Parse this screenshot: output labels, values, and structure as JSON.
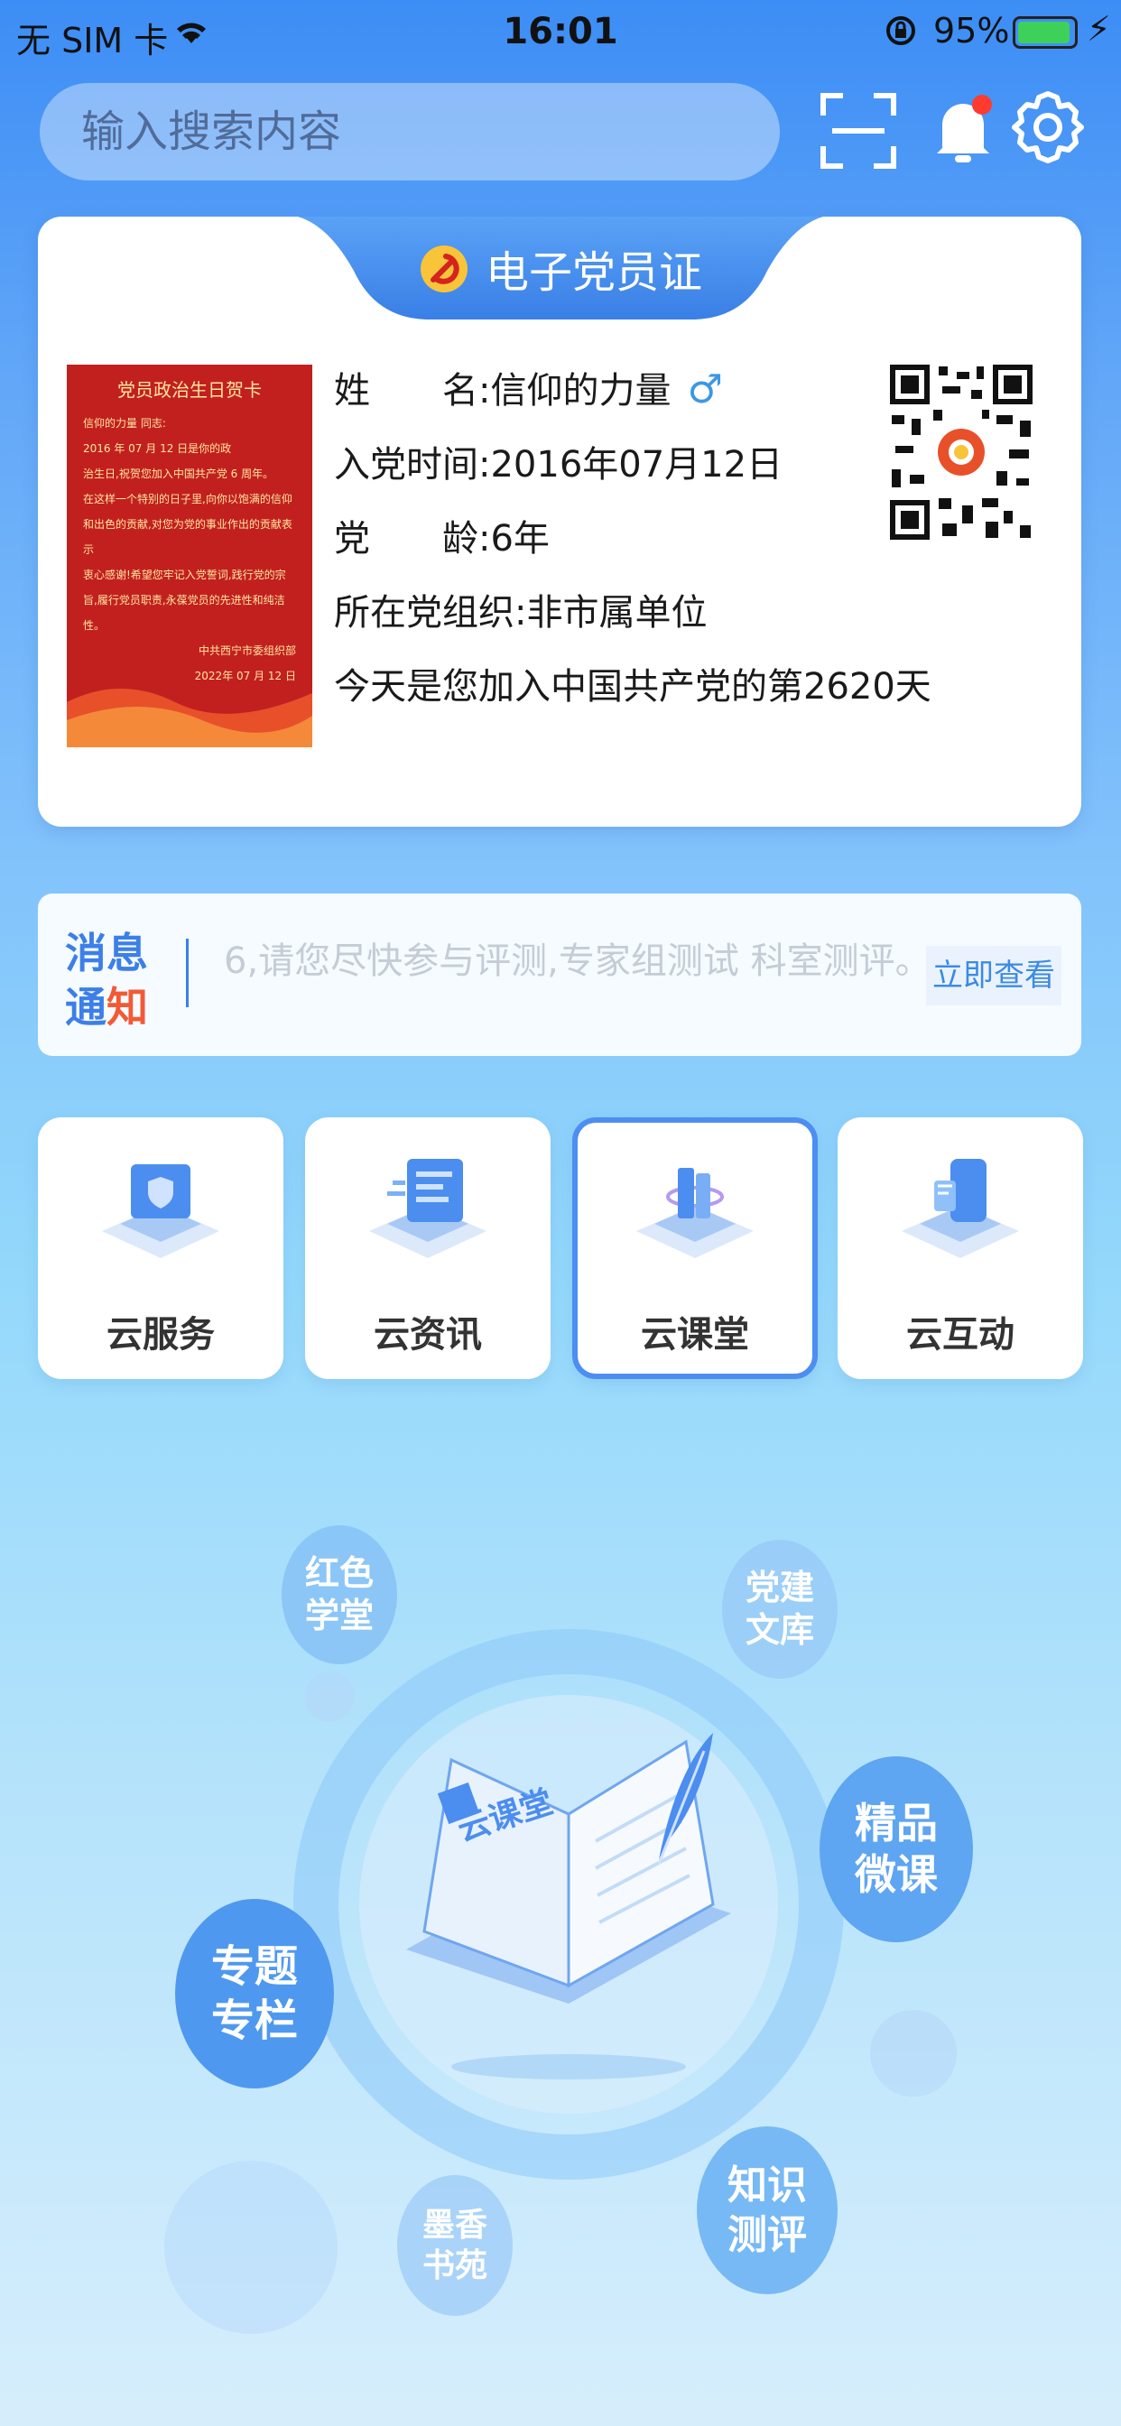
{
  "status_bar": {
    "carrier": "无 SIM 卡",
    "time": "16:01",
    "battery_pct": "95%",
    "battery_level": 0.95
  },
  "search": {
    "placeholder": "输入搜索内容"
  },
  "card": {
    "title": "电子党员证",
    "greeting_title": "党员政治生日贺卡",
    "greeting_lines": [
      "信仰的力量 同志:",
      "2016 年 07 月 12 日是你的政",
      "治生日,祝贺您加入中国共产党 6 周年。",
      "在这样一个特别的日子里,向你以饱满的信仰",
      "和出色的贡献,对您为党的事业作出的贡献表示",
      "衷心感谢!希望您牢记入党誓词,践行党的宗",
      "旨,履行党员职责,永葆党员的先进性和纯洁",
      "性。",
      "中共西宁市委组织部",
      "2022年 07 月 12 日"
    ],
    "name_label": "姓　　名:",
    "name_value": "信仰的力量",
    "join_label": "入党时间:",
    "join_value": "2016年07月12日",
    "age_label": "党　　龄:",
    "age_value": "6年",
    "org_label": "所在党组织:",
    "org_value": "非市属单位",
    "days_text": "今天是您加入中国共产党的第2620天"
  },
  "notice": {
    "label_top": "消息",
    "label_bottom_1": "通",
    "label_bottom_2": "知",
    "text": "6,请您尽快参与评测,专家组测试 科室测评。",
    "button": "立即查看"
  },
  "tiles": [
    {
      "label": "云服务"
    },
    {
      "label": "云资讯"
    },
    {
      "label": "云课堂"
    },
    {
      "label": "云互动"
    }
  ],
  "orbit": {
    "center_text": "云课堂",
    "items": [
      {
        "label": "红色\n学堂"
      },
      {
        "label": "党建\n文库"
      },
      {
        "label": "精品\n微课"
      },
      {
        "label": "专题\n专栏"
      },
      {
        "label": "知识\n测评"
      },
      {
        "label": "墨香\n书苑"
      }
    ]
  },
  "colors": {
    "accent": "#3c8df5",
    "notice_red": "#f25a36",
    "card_red": "#c2201f"
  }
}
